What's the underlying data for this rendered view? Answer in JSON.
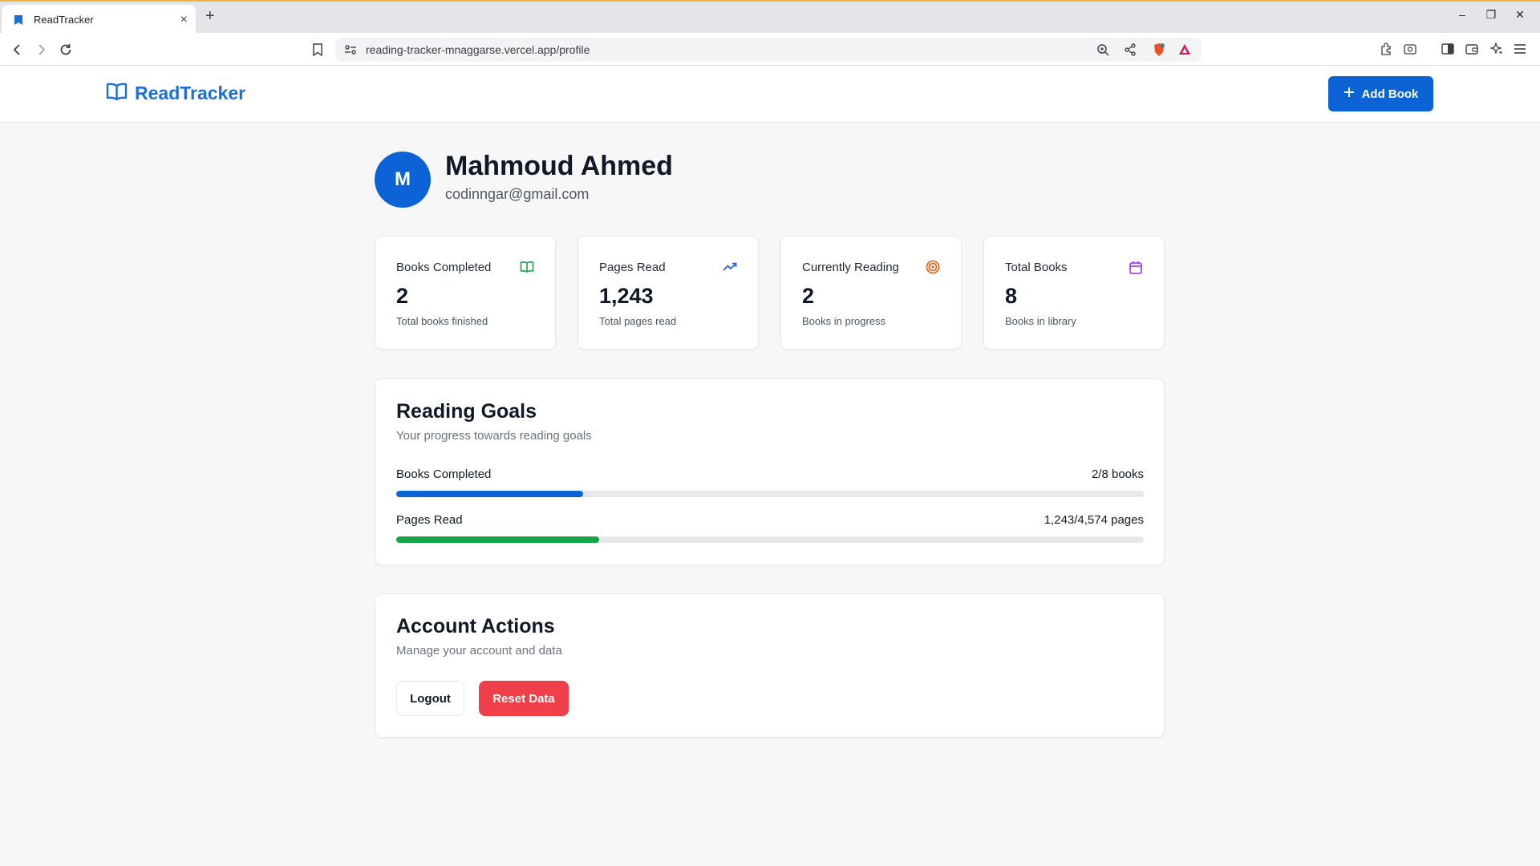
{
  "browser": {
    "tab_title": "ReadTracker",
    "url": "reading-tracker-mnaggarse.vercel.app/profile"
  },
  "header": {
    "brand": "ReadTracker",
    "add_book_label": "Add Book"
  },
  "profile": {
    "initial": "M",
    "name": "Mahmoud Ahmed",
    "email": "codinngar@gmail.com"
  },
  "stats": [
    {
      "label": "Books Completed",
      "value": "2",
      "sub": "Total books finished",
      "icon": "book-open-icon",
      "color": "#16a34a"
    },
    {
      "label": "Pages Read",
      "value": "1,243",
      "sub": "Total pages read",
      "icon": "trending-up-icon",
      "color": "#2563eb"
    },
    {
      "label": "Currently Reading",
      "value": "2",
      "sub": "Books in progress",
      "icon": "target-icon",
      "color": "#ea580c"
    },
    {
      "label": "Total Books",
      "value": "8",
      "sub": "Books in library",
      "icon": "calendar-icon",
      "color": "#9333ea"
    }
  ],
  "goals": {
    "title": "Reading Goals",
    "subtitle": "Your progress towards reading goals",
    "items": [
      {
        "label": "Books Completed",
        "value_text": "2/8 books",
        "progress": 0.25,
        "color": "#0b63d6"
      },
      {
        "label": "Pages Read",
        "value_text": "1,243/4,574 pages",
        "progress": 0.2718,
        "color": "#16a34a"
      }
    ]
  },
  "account": {
    "title": "Account Actions",
    "subtitle": "Manage your account and data",
    "logout_label": "Logout",
    "reset_label": "Reset Data"
  }
}
